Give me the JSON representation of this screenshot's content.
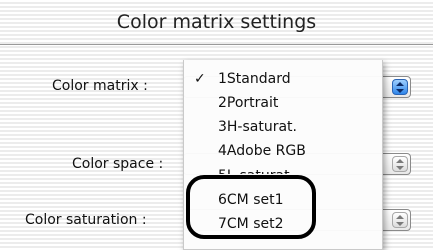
{
  "window": {
    "title": "Color matrix settings"
  },
  "rows": {
    "color_matrix": {
      "label": "Color matrix :"
    },
    "color_space": {
      "label": "Color space :"
    },
    "color_saturation": {
      "label": "Color saturation :"
    }
  },
  "menu": {
    "check_mark": "✓",
    "items": [
      {
        "label": "1Standard",
        "checked": true
      },
      {
        "label": "2Portrait"
      },
      {
        "label": "3H-saturat."
      },
      {
        "label": "4Adobe RGB"
      },
      {
        "label": "5L-saturat."
      },
      {
        "label": "6CM set1"
      },
      {
        "label": "7CM set2"
      }
    ]
  },
  "colors": {
    "accent": "#2f86ea",
    "highlight_outline": "#000000"
  },
  "icons": {
    "popup_stepper": "up-down-arrows-icon"
  }
}
